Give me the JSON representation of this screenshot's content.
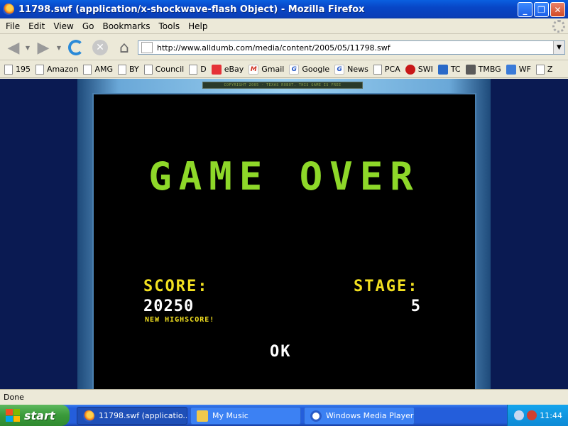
{
  "window": {
    "title": "11798.swf (application/x-shockwave-flash Object) - Mozilla Firefox",
    "buttons": {
      "minimize": "_",
      "maximize": "❐",
      "close": "✕"
    }
  },
  "menubar": {
    "items": [
      "File",
      "Edit",
      "View",
      "Go",
      "Bookmarks",
      "Tools",
      "Help"
    ]
  },
  "navigation": {
    "url": "http://www.alldumb.com/media/content/2005/05/11798.swf"
  },
  "bookmarks": {
    "items": [
      {
        "label": "195"
      },
      {
        "label": "Amazon"
      },
      {
        "label": "AMG"
      },
      {
        "label": "BY"
      },
      {
        "label": "Council"
      },
      {
        "label": "D"
      },
      {
        "label": "eBay"
      },
      {
        "label": "Gmail"
      },
      {
        "label": "Google"
      },
      {
        "label": "News"
      },
      {
        "label": "PCA"
      },
      {
        "label": "SWI"
      },
      {
        "label": "TC"
      },
      {
        "label": "TMBG"
      },
      {
        "label": "WF"
      },
      {
        "label": "Z"
      }
    ]
  },
  "game": {
    "copyright": "COPYRIGHT 2005 - TEXAS ROBOT. THIS GAME IS FREE",
    "heading": "GAME OVER",
    "score_label": "SCORE:",
    "score_value": "20250",
    "new_highscore": "NEW HIGHSCORE!",
    "stage_label": "STAGE:",
    "stage_value": "5",
    "ok_label": "OK",
    "colors": {
      "heading": "#8ed829",
      "labels": "#f2e020",
      "values": "#ffffff",
      "background": "#000000"
    }
  },
  "statusbar": {
    "text": "Done"
  },
  "taskbar": {
    "start_label": "start",
    "tasks": [
      {
        "label": "11798.swf (applicatio..."
      },
      {
        "label": "My Music"
      },
      {
        "label": "Windows Media Player"
      }
    ],
    "clock": "11:44"
  }
}
